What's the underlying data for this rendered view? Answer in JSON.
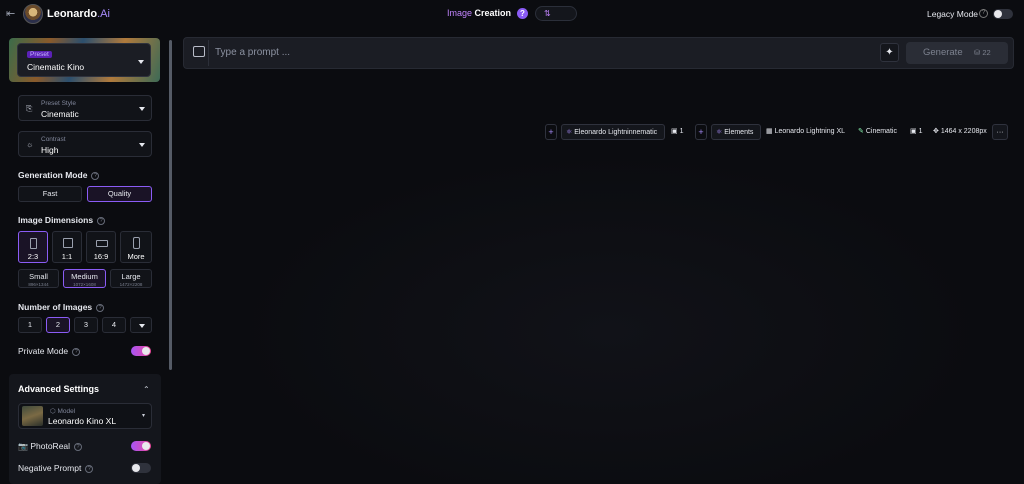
{
  "topbar": {
    "back_icon": "arrow-left-to-bar-icon",
    "brand_name": "Leonardo",
    "brand_suffix": ".Ai",
    "title_image": "Image",
    "title_creation": "Creation",
    "help_glyph": "?",
    "mode_glyph": "⇅",
    "legacy_label": "Legacy Mode",
    "legacy_help": "?"
  },
  "sidebar": {
    "preset": {
      "label": "Preset",
      "value": "Cinematic Kino"
    },
    "preset_style": {
      "label": "Preset Style",
      "value": "Cinematic"
    },
    "contrast": {
      "label": "Contrast",
      "value": "High"
    },
    "generation_mode": {
      "title": "Generation Mode",
      "options": [
        "Fast",
        "Quality"
      ],
      "selected": "Quality"
    },
    "image_dimensions": {
      "title": "Image Dimensions",
      "ratios": [
        "2:3",
        "1:1",
        "16:9",
        "More"
      ],
      "selected_ratio": "2:3",
      "sizes": [
        {
          "label": "Small",
          "sub": "896×1344"
        },
        {
          "label": "Medium",
          "sub": "1072×1608"
        },
        {
          "label": "Large",
          "sub": "1472×2208"
        }
      ],
      "selected_size": "Medium"
    },
    "number_of_images": {
      "title": "Number of Images",
      "options": [
        "1",
        "2",
        "3",
        "4"
      ],
      "selected": "2"
    },
    "private_mode": {
      "label": "Private Mode",
      "on": true
    },
    "advanced": {
      "title": "Advanced Settings",
      "model_label": "Model",
      "model_value": "Leonardo Kino XL",
      "photoreal_label": "PhotoReal",
      "photoreal_on": true,
      "negative_prompt_label": "Negative Prompt",
      "negative_prompt_on": false
    }
  },
  "prompt": {
    "placeholder": "Type a prompt ...",
    "value": "",
    "generate_label": "Generate",
    "cost": "22"
  },
  "chips": {
    "model_chip": "Eleonardo Lightninnematic",
    "count_a": "1",
    "elements_chip": "Elements",
    "model_name": "Leonardo Lightning XL",
    "style_name": "Cinematic",
    "count_b": "1",
    "dimensions": "1464 x 2208px",
    "more": "···"
  },
  "colors": {
    "accent": "#8b5cf6",
    "background": "#0b0c10",
    "panel": "#14161c"
  }
}
